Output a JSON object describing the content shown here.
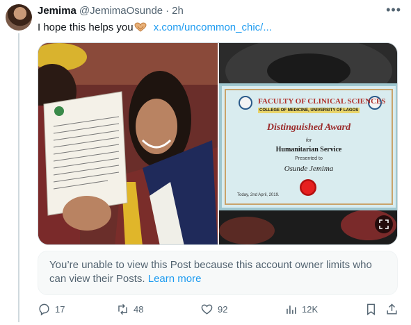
{
  "author": {
    "name": "Jemima",
    "handle": "@JemimaOsunde",
    "separator": "·",
    "time": "2h",
    "avatar_icon": "profile-photo"
  },
  "post": {
    "text": "I hope this helps you",
    "emoji_icon": "heart-hands-emoji",
    "link": "x.com/uncommon_chic/..."
  },
  "media": {
    "left_image": {
      "description_icon": "graduate-holding-letter-photo"
    },
    "right_image": {
      "certificate": {
        "faculty": "FACULTY OF CLINICAL SCIENCES",
        "college": "COLLEGE OF MEDICINE, UNIVERSITY OF LAGOS",
        "award": "Distinguished Award",
        "for": "for",
        "service": "Humanitarian Service",
        "presented": "Presented to",
        "recipient": "Osunde Jemima",
        "date": "Today, 2nd April, 2019."
      },
      "expand_icon": "expand-icon"
    }
  },
  "notice": {
    "text": "You’re unable to view this Post because this account owner limits who can view their Posts.",
    "link": "Learn more"
  },
  "actions": {
    "replies": "17",
    "reposts": "48",
    "likes": "92",
    "views": "12K"
  },
  "colors": {
    "accent": "#1d9bf0",
    "muted": "#536471",
    "text": "#0f1419"
  }
}
